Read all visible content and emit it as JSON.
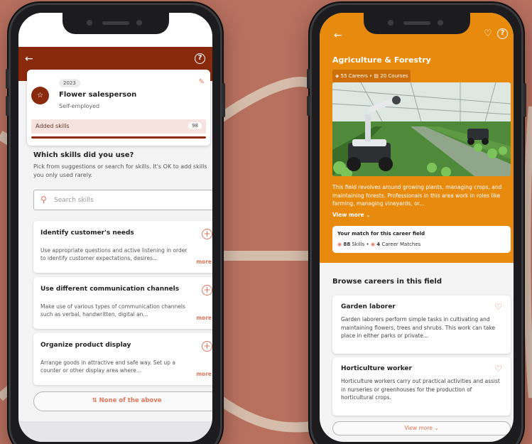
{
  "colors": {
    "background": "#b8705f",
    "left_header": "#8a2a0c",
    "right_hero": "#e88a0e",
    "accent": "#e0765a"
  },
  "left_phone": {
    "icons": {
      "back": "arrow-left-icon",
      "help": "help-circle-icon",
      "edit": "pencil-icon",
      "job": "star-icon",
      "search": "search-icon"
    },
    "job_card": {
      "year": "2023",
      "title": "Flower salesperson",
      "subtitle": "Self-employed",
      "added_skills_label": "Added skills",
      "added_skills_count": "98"
    },
    "question_title": "Which skills did you use?",
    "question_desc": "Pick from suggestions or search for skills. It's OK to add skills you only used rarely.",
    "search_placeholder": "Search skills",
    "skills": [
      {
        "title": "Identify customer's needs",
        "desc": "Use appropriate questions and active listening in order to identify customer expectations, desires...",
        "more": "more"
      },
      {
        "title": "Use different communication channels",
        "desc": "Make use of various types of communication channels such as verbal, handwritten, digital an...",
        "more": "more"
      },
      {
        "title": "Organize product display",
        "desc": "Arrange goods in attractive and safe way. Set up a counter or other display area where...",
        "more": "more"
      }
    ],
    "none_button": "None of the above"
  },
  "right_phone": {
    "icons": {
      "back": "arrow-left-icon",
      "favorite": "heart-icon",
      "help": "help-circle-icon"
    },
    "field_title": "Agriculture & Forestry",
    "careers_stat": "55 Careers",
    "courses_stat": "20 Courses",
    "field_desc": "This field revolves around growing plants, managing crops, and maintaining forests. Professionals in this area work in roles like farming, managing vineyards, or...",
    "view_more_link": "View more",
    "match": {
      "title": "Your match for this career field",
      "skills_num": "88",
      "skills_label": "Skills",
      "careers_num": "4",
      "careers_label": "Career Matches"
    },
    "browse_title": "Browse careers in this field",
    "careers": [
      {
        "title": "Garden laborer",
        "desc": "Garden laborers perform simple tasks in cultivating and maintaining flowers, trees and shrubs. This work can take place in either parks or private..."
      },
      {
        "title": "Horticulture worker",
        "desc": "Horticulture workers carry out practical activities and assist in nurseries or greenhouses for the production of horticultural crops."
      }
    ],
    "view_more_button": "View more"
  }
}
